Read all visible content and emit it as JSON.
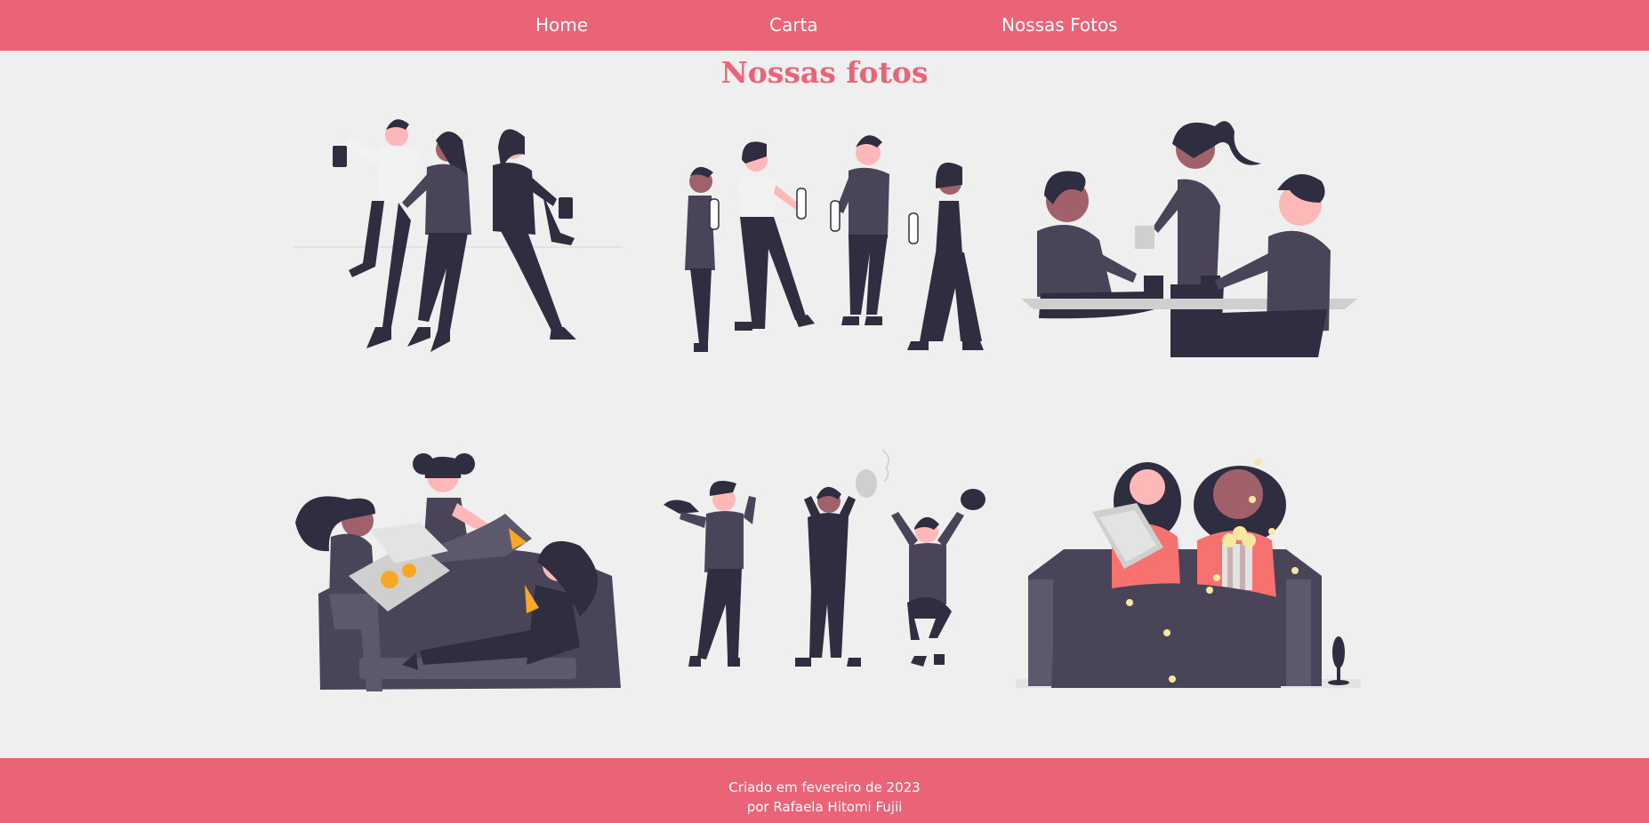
{
  "nav": {
    "home_label": "Home",
    "carta_label": "Carta",
    "fotos_label": "Nossas Fotos"
  },
  "main": {
    "title": "Nossas fotos",
    "photos": [
      {
        "name": "friends-dancing-illustration"
      },
      {
        "name": "friends-drinking-illustration"
      },
      {
        "name": "friends-cafe-illustration"
      },
      {
        "name": "friends-pizza-sofa-illustration"
      },
      {
        "name": "friends-cheering-illustration"
      },
      {
        "name": "friends-movie-night-illustration"
      }
    ]
  },
  "footer": {
    "line1": "Criado em fevereiro de 2023",
    "line2": "por Rafaela Hitomi Fujii"
  },
  "colors": {
    "accent": "#ea6377",
    "background": "#efefef",
    "dark": "#2f2e41",
    "purple": "#4a4458",
    "skin_light": "#ffb8b8",
    "skin_dark": "#a0616a",
    "shirt_light": "#f2f2f2",
    "coral": "#f6726f"
  }
}
